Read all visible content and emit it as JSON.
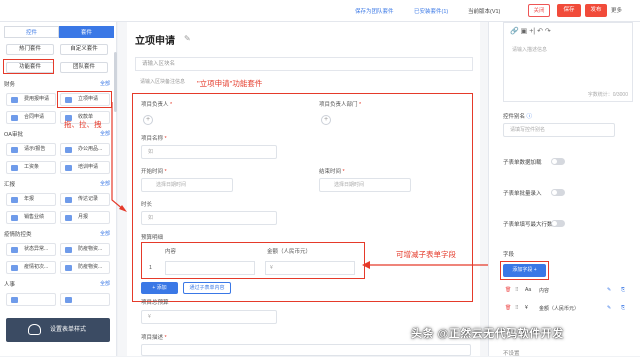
{
  "topbar": {
    "save_as_team": "保存为团队套件",
    "installed": "已安装套件(1)",
    "version": "当前版本(V1)",
    "close": "关闭",
    "save": "保存",
    "publish": "发布",
    "more": "更多"
  },
  "left": {
    "tab_controls": "控件",
    "tab_suite": "套件",
    "hot_suite": "热门套件",
    "custom_suite": "自定义套件",
    "func_suite": "功能套件",
    "team_suite": "团队套件",
    "all": "全部",
    "sections": [
      {
        "title": "财务",
        "items": [
          "费用报申请",
          "立项申请",
          "合同申请",
          "收款单"
        ]
      },
      {
        "title": "OA审批",
        "items": [
          "请示/报告",
          "办公用品...",
          "工资条",
          "培训申请"
        ]
      },
      {
        "title": "汇报",
        "items": [
          "年报",
          "传达记录",
          "销售业绩",
          "月报"
        ]
      },
      {
        "title": "疫情防控类",
        "items": [
          "状态异常...",
          "防疫物资...",
          "疫情初次...",
          "防疫物资..."
        ]
      },
      {
        "title": "人事",
        "items": [
          "",
          ""
        ]
      }
    ],
    "settings_label": "设置表单样式"
  },
  "canvas": {
    "title": "立项申请",
    "section_placeholder": "请输入区块名",
    "section_desc": "请输入区块备注信息",
    "annot_suite": "\"立项申请\"功能套件",
    "annot_drag": "拖、拉、拽",
    "annot_subform": "可增减子表单字段",
    "fields": {
      "owner": "项目负责人",
      "dept": "项目负责人部门",
      "name": "项目名称",
      "name_ph": "如",
      "start": "开始时间",
      "start_ph": "选择日期时间",
      "end": "结束时间",
      "end_ph": "选择日期时间",
      "duration": "时长",
      "duration_ph": "如",
      "budget": "预算明细",
      "content": "内容",
      "amount": "金额（人民币元）",
      "amount_ph": "¥",
      "row_no": "1",
      "add": "添加",
      "import": "通过子表单内容",
      "total_budget": "项目总预算",
      "total_ph": "¥",
      "desc": "项目描述"
    }
  },
  "right": {
    "placeholder_hint": "请输入描述信息",
    "char_count": "字数统计：0/3000",
    "alias": "控件别名",
    "alias_placeholder": "请填写控件别名",
    "sub_single": "子表单数据加载",
    "sub_batch": "子表单批量录入",
    "sub_max": "子表单填写最大行数",
    "field_title": "字段",
    "add_field": "添加字段 +",
    "field_rows": [
      {
        "type": "Aa",
        "name": "内容"
      },
      {
        "type": "¥",
        "name": "金额（人民币元）"
      }
    ],
    "bottom_cut": "不设置"
  },
  "watermark": "头条 @正然云无代码软件开发"
}
